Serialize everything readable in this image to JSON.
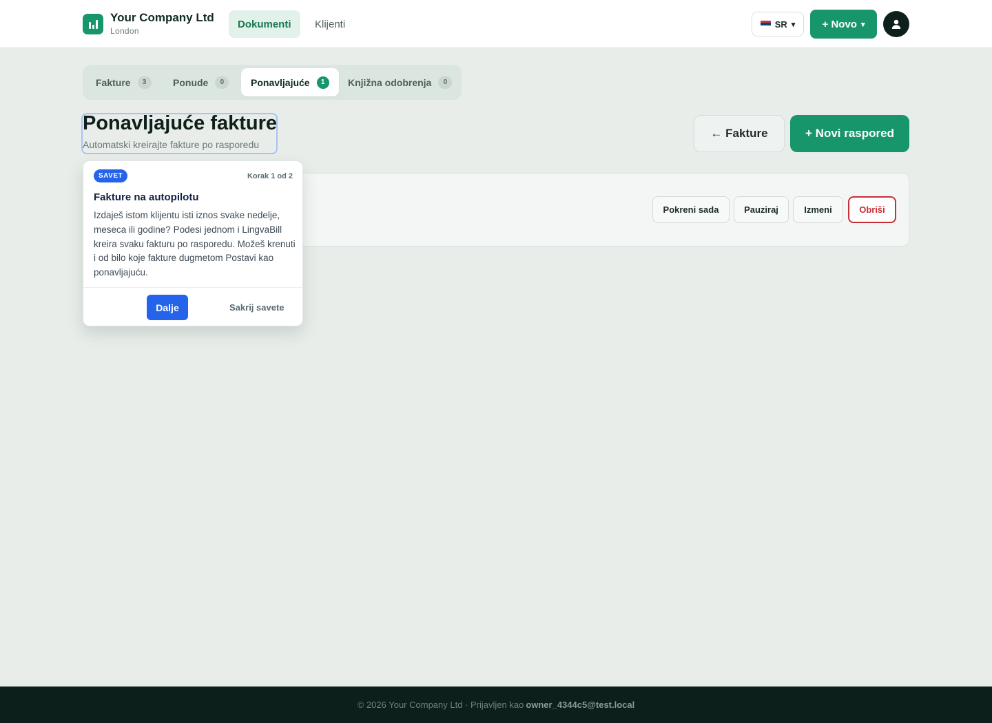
{
  "header": {
    "company_name": "Your Company Ltd",
    "company_city": "London",
    "logo_icon": "bar-chart-icon",
    "nav": [
      {
        "label": "Dokumenti",
        "active": true
      },
      {
        "label": "Klijenti",
        "active": false
      }
    ],
    "language": {
      "code": "SR",
      "flag_icon": "serbia-flag-icon",
      "chevron": "▾"
    },
    "new_button": {
      "label": "+ Novo",
      "chevron": "▾"
    },
    "avatar_icon": "user-icon"
  },
  "tabs": [
    {
      "label": "Fakture",
      "count": "3",
      "active": false
    },
    {
      "label": "Ponude",
      "count": "0",
      "active": false
    },
    {
      "label": "Ponavljajuće",
      "count": "1",
      "active": true
    },
    {
      "label": "Knjižna odobrenja",
      "count": "0",
      "active": false
    }
  ],
  "page": {
    "title": "Ponavljajuće fakture",
    "subtitle": "Automatski kreirajte fakture po rasporedu",
    "back_button": "← Fakture",
    "new_schedule_button": "+ Novi raspored"
  },
  "schedule_card": {
    "actions": {
      "run": "Pokreni sada",
      "pause": "Pauziraj",
      "edit": "Izmeni",
      "delete": "Obriši"
    }
  },
  "tip": {
    "badge": "SAVET",
    "step": "Korak 1 od 2",
    "title": "Fakture na autopilotu",
    "body": "Izdaješ istom klijentu isti iznos svake nedelje, meseca ili godine? Podesi jednom i LingvaBill kreira svaku fakturu po rasporedu. Možeš krenuti i od bilo koje fakture dugmetom Postavi kao ponavljajuću.",
    "next_button": "Dalje",
    "hide_button": "Sakrij savete"
  },
  "footer": {
    "text": "© 2026 Your Company Ltd · Prijavljen kao",
    "user": "owner_4344c5@test.local"
  },
  "colors": {
    "brand_green": "#17956b",
    "tip_blue": "#2563eb",
    "danger_red": "#c62f36",
    "footer_bg": "#0d1f1a",
    "page_bg": "#e8edea"
  }
}
